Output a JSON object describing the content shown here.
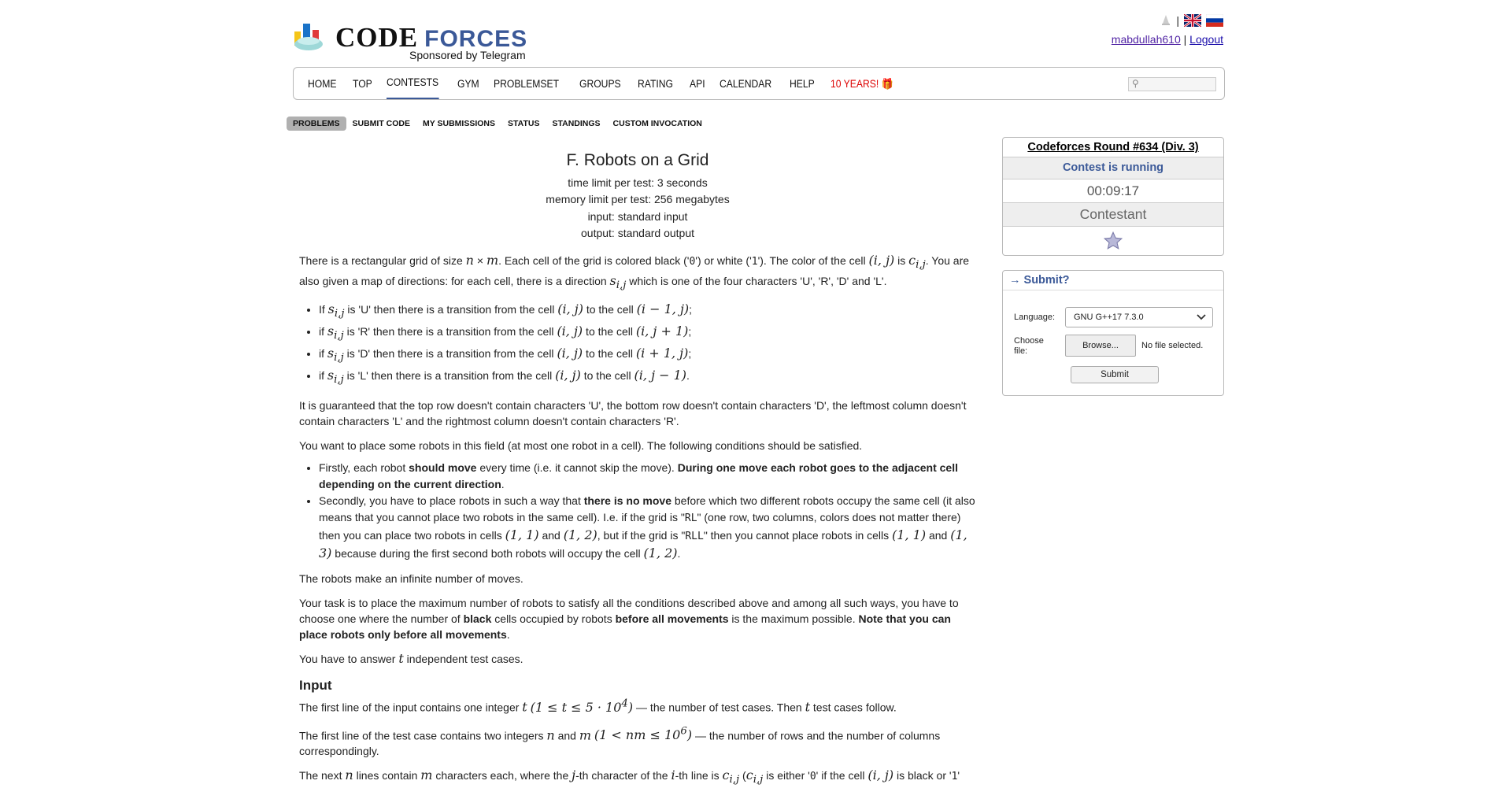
{
  "header": {
    "logo_word_code": "CODE",
    "logo_word_forces": "FORCES",
    "sponsor": "Sponsored by Telegram",
    "username": "mabdullah610",
    "separator": "|",
    "logout": "Logout"
  },
  "nav": {
    "items": [
      "HOME",
      "TOP",
      "CONTESTS",
      "GYM",
      "PROBLEMSET",
      "GROUPS",
      "RATING",
      "API",
      "CALENDAR",
      "HELP",
      "10 YEARS! 🎁"
    ],
    "active": "CONTESTS",
    "search_icon": "search-icon"
  },
  "subnav": {
    "items": [
      "PROBLEMS",
      "SUBMIT CODE",
      "MY SUBMISSIONS",
      "STATUS",
      "STANDINGS",
      "CUSTOM INVOCATION"
    ],
    "active": "PROBLEMS"
  },
  "contest": {
    "title": "Codeforces Round #634 (Div. 3)",
    "status": "Contest is running",
    "timer": "00:09:17",
    "role": "Contestant",
    "star_icon": "star-icon"
  },
  "submit": {
    "header": "→ Submit?",
    "language_label": "Language:",
    "language_value": "GNU G++17 7.3.0",
    "file_label_1": "Choose",
    "file_label_2": "file:",
    "browse": "Browse...",
    "no_file": "No file selected.",
    "submit_button": "Submit"
  },
  "problem": {
    "title": "F. Robots on a Grid",
    "time_limit": "time limit per test: 3 seconds",
    "memory_limit": "memory limit per test: 256 megabytes",
    "input": "input: standard input",
    "output": "output: standard output",
    "input_heading": "Input"
  },
  "colors": {
    "brand_blue": "#3b5998",
    "years_red": "#dd0000",
    "user_link": "#5226a5"
  }
}
